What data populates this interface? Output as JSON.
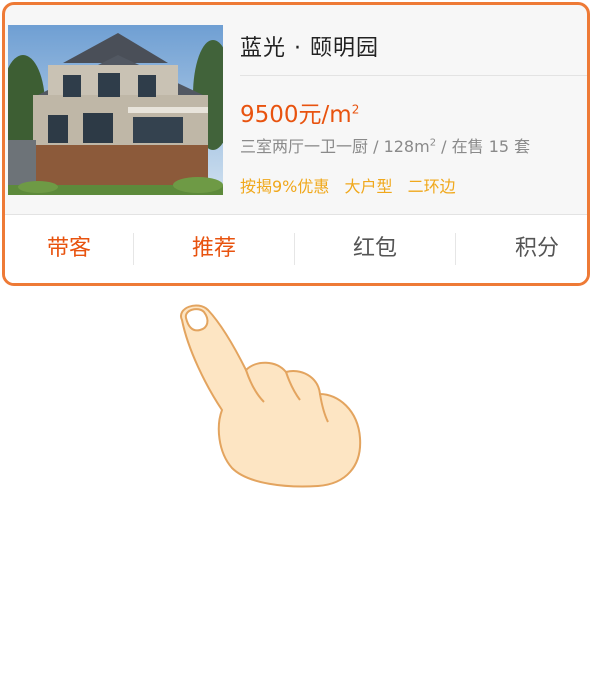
{
  "listing": {
    "title": "蓝光 · 颐明园",
    "price_value": "9500元/",
    "price_unit": "m",
    "price_sup": "2",
    "spec_prefix": "三室两厅一卫一厨 / 128m",
    "spec_sup": "2",
    "spec_suffix": " / 在售 15 套",
    "tags": [
      "按揭9%优惠",
      "大户型",
      "二环边"
    ]
  },
  "actions": [
    {
      "label": "带客"
    },
    {
      "label": "推荐"
    },
    {
      "label": "红包"
    },
    {
      "label": "积分"
    }
  ],
  "colors": {
    "accent": "#e8530f",
    "card_border": "#ee7a36",
    "tag": "#f0a81c",
    "secondary_text": "#8a8a8a"
  },
  "icons": {
    "gesture": "finger-tap-icon"
  }
}
